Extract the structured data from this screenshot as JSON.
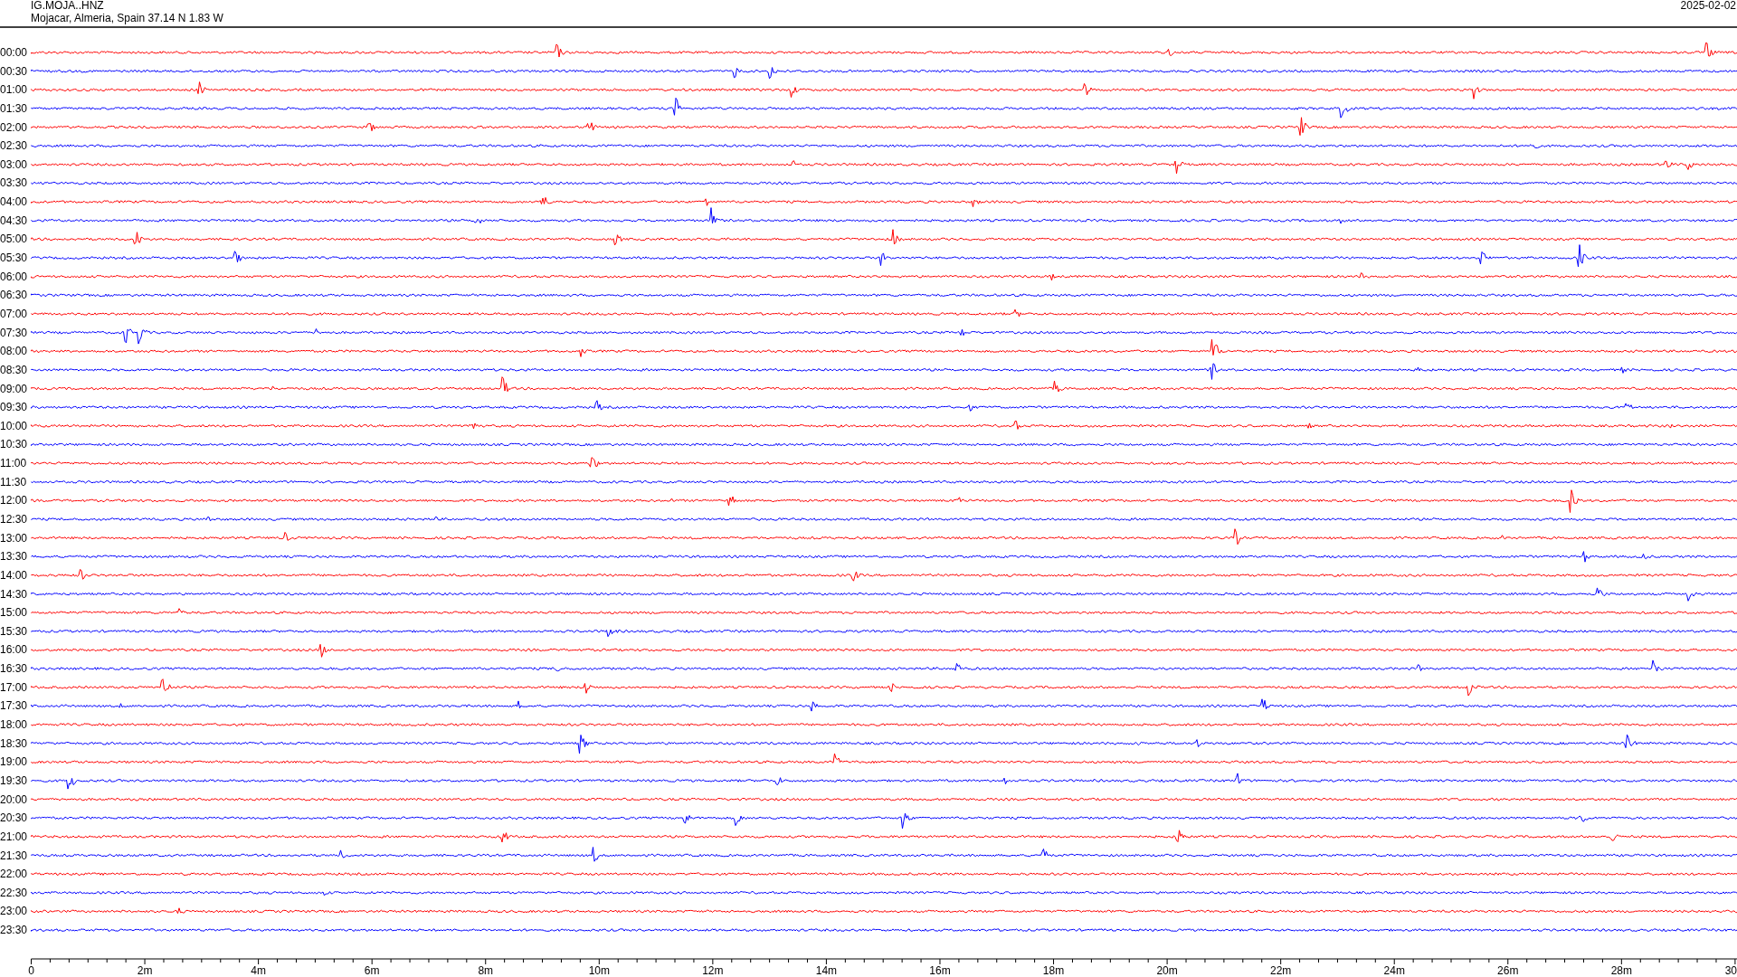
{
  "header": {
    "station": "IG.MOJA..HNZ",
    "location": "Mojacar, Almeria, Spain  37.14 N 1.83 W",
    "date": "2025-02-02"
  },
  "rows": [
    {
      "label": "00:00",
      "color": "#ff0000"
    },
    {
      "label": "00:30",
      "color": "#0000ff"
    },
    {
      "label": "01:00",
      "color": "#ff0000"
    },
    {
      "label": "01:30",
      "color": "#0000ff"
    },
    {
      "label": "02:00",
      "color": "#ff0000"
    },
    {
      "label": "02:30",
      "color": "#0000ff"
    },
    {
      "label": "03:00",
      "color": "#ff0000"
    },
    {
      "label": "03:30",
      "color": "#0000ff"
    },
    {
      "label": "04:00",
      "color": "#ff0000"
    },
    {
      "label": "04:30",
      "color": "#0000ff"
    },
    {
      "label": "05:00",
      "color": "#ff0000"
    },
    {
      "label": "05:30",
      "color": "#0000ff"
    },
    {
      "label": "06:00",
      "color": "#ff0000"
    },
    {
      "label": "06:30",
      "color": "#0000ff"
    },
    {
      "label": "07:00",
      "color": "#ff0000"
    },
    {
      "label": "07:30",
      "color": "#0000ff"
    },
    {
      "label": "08:00",
      "color": "#ff0000"
    },
    {
      "label": "08:30",
      "color": "#0000ff"
    },
    {
      "label": "09:00",
      "color": "#ff0000"
    },
    {
      "label": "09:30",
      "color": "#0000ff"
    },
    {
      "label": "10:00",
      "color": "#ff0000"
    },
    {
      "label": "10:30",
      "color": "#0000ff"
    },
    {
      "label": "11:00",
      "color": "#ff0000"
    },
    {
      "label": "11:30",
      "color": "#0000ff"
    },
    {
      "label": "12:00",
      "color": "#ff0000"
    },
    {
      "label": "12:30",
      "color": "#0000ff"
    },
    {
      "label": "13:00",
      "color": "#ff0000"
    },
    {
      "label": "13:30",
      "color": "#0000ff"
    },
    {
      "label": "14:00",
      "color": "#ff0000"
    },
    {
      "label": "14:30",
      "color": "#0000ff"
    },
    {
      "label": "15:00",
      "color": "#ff0000"
    },
    {
      "label": "15:30",
      "color": "#0000ff"
    },
    {
      "label": "16:00",
      "color": "#ff0000"
    },
    {
      "label": "16:30",
      "color": "#0000ff"
    },
    {
      "label": "17:00",
      "color": "#ff0000"
    },
    {
      "label": "17:30",
      "color": "#0000ff"
    },
    {
      "label": "18:00",
      "color": "#ff0000"
    },
    {
      "label": "18:30",
      "color": "#0000ff"
    },
    {
      "label": "19:00",
      "color": "#ff0000"
    },
    {
      "label": "19:30",
      "color": "#0000ff"
    },
    {
      "label": "20:00",
      "color": "#ff0000"
    },
    {
      "label": "20:30",
      "color": "#0000ff"
    },
    {
      "label": "21:00",
      "color": "#ff0000"
    },
    {
      "label": "21:30",
      "color": "#0000ff"
    },
    {
      "label": "22:00",
      "color": "#ff0000"
    },
    {
      "label": "22:30",
      "color": "#0000ff"
    },
    {
      "label": "23:00",
      "color": "#ff0000"
    },
    {
      "label": "23:30",
      "color": "#0000ff"
    }
  ],
  "x_axis": {
    "labels": [
      "0",
      "2m",
      "4m",
      "6m",
      "8m",
      "10m",
      "12m",
      "14m",
      "16m",
      "18m",
      "20m",
      "22m",
      "24m",
      "26m",
      "28m",
      "30"
    ]
  }
}
